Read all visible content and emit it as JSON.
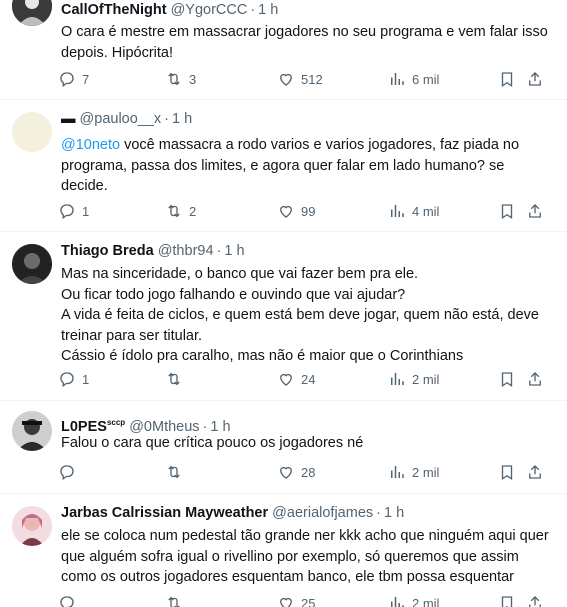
{
  "tweets": [
    {
      "name": "CallOfTheNight",
      "handle": "@YgorCCC",
      "time": "1 h",
      "lines": [
        "O cara é mestre em massacrar jogadores no seu programa e vem falar isso",
        "depois. Hipócrita!"
      ],
      "replies": "7",
      "retweets": "3",
      "likes": "512",
      "views": "6 mil"
    },
    {
      "name": "▬",
      "handle": "@pauloo__x",
      "time": "1 h",
      "mention": "@10neto",
      "lines": [
        " você massacra a rodo varios e varios jogadores, faz piada no",
        "programa, passa dos limites, e agora quer falar em lado humano? se",
        "decide."
      ],
      "replies": "1",
      "retweets": "2",
      "likes": "99",
      "views": "4 mil"
    },
    {
      "name": "Thiago Breda",
      "handle": "@thbr94",
      "time": "1 h",
      "lines": [
        "Mas na sinceridade, o banco que vai fazer bem pra ele.",
        "Ou ficar todo jogo falhando e ouvindo que vai ajudar?",
        "A vida é feita de ciclos, e quem está bem deve jogar, quem não está, deve",
        "treinar para ser titular.",
        "Cássio é ídolo pra caralho, mas não é maior que o Corinthians"
      ],
      "replies": "1",
      "retweets": "",
      "likes": "24",
      "views": "2 mil"
    },
    {
      "name": "L0PES",
      "name_suffix": "sccp",
      "handle": "@0Mtheus",
      "time": "1 h",
      "lines": [
        "Falou o cara que crítica pouco os jogadores né"
      ],
      "replies": "",
      "retweets": "",
      "likes": "28",
      "views": "2 mil"
    },
    {
      "name": "Jarbas Calrissian Mayweather",
      "handle": "@aerialofjames",
      "time": "1 h",
      "lines": [
        "ele se coloca num pedestal tão grande ner kkk acho que ninguém aqui quer",
        "que alguém sofra igual o rivellino por exemplo, só queremos que assim",
        "como os outros jogadores esquentam banco, ele tbm possa esquentar"
      ],
      "replies": "",
      "retweets": "",
      "likes": "25",
      "views": "2 mil"
    }
  ],
  "dot": "·",
  "colors": {
    "text": "#0f1419",
    "secondary": "#536471",
    "link": "#1d9bf0",
    "divider": "#eff3f4"
  },
  "icons": [
    "reply-icon",
    "retweet-icon",
    "like-icon",
    "views-icon",
    "bookmark-icon",
    "share-icon"
  ]
}
